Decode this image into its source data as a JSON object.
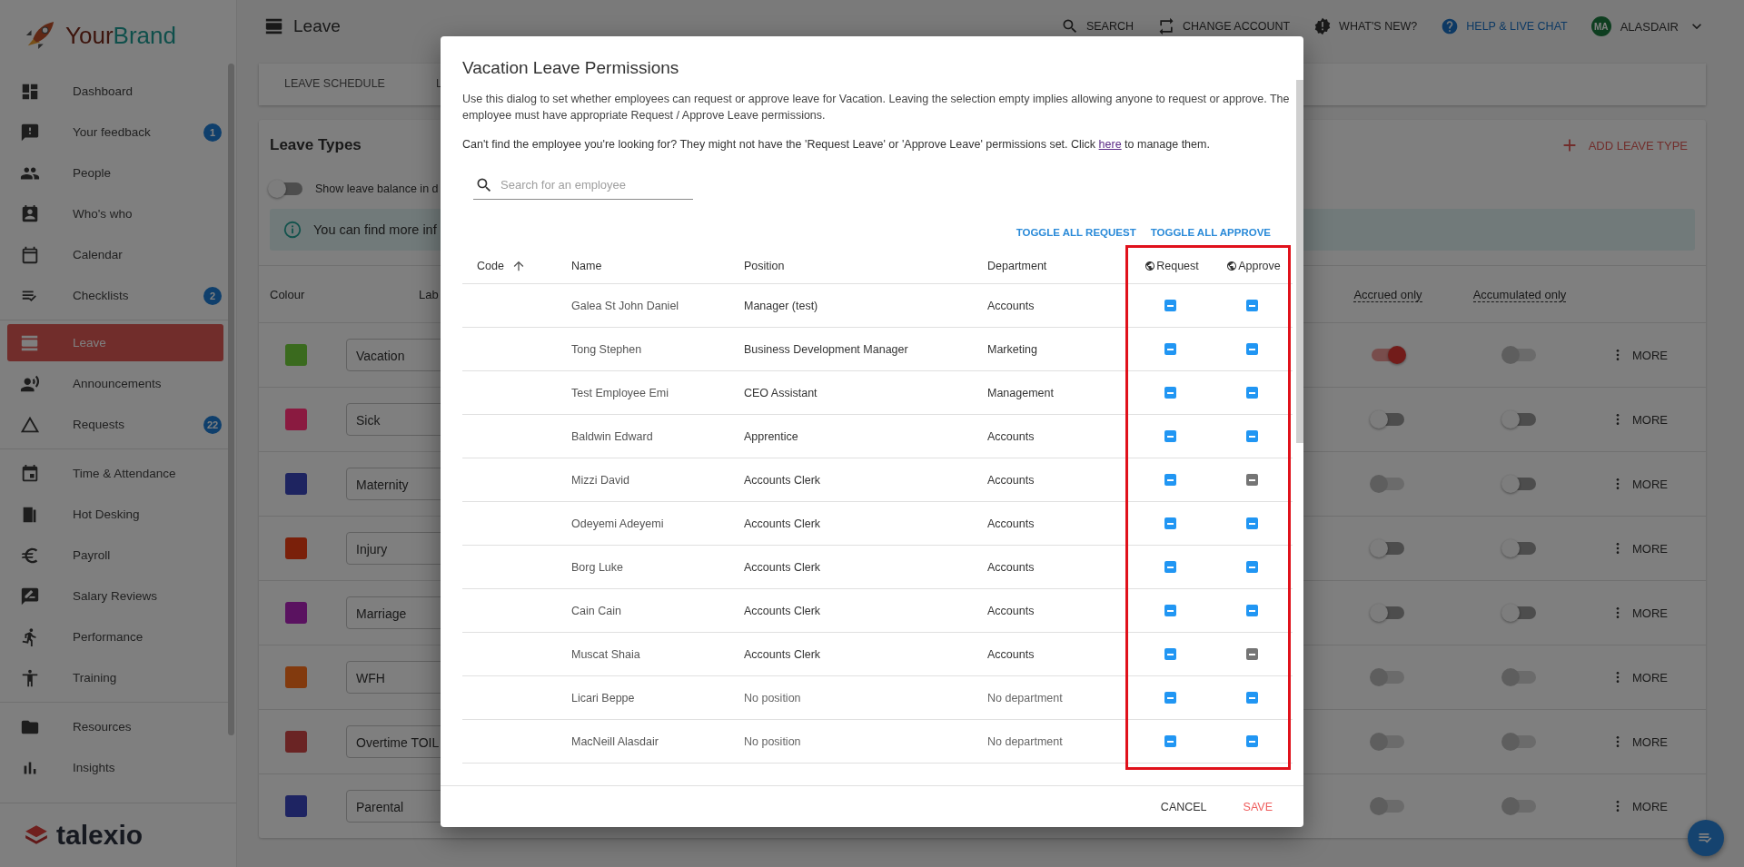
{
  "brand": {
    "parts": [
      "Your",
      "Brand"
    ]
  },
  "sidebar": {
    "groups": [
      [
        {
          "label": "Dashboard",
          "selected": false
        },
        {
          "label": "Your feedback",
          "badge": "1",
          "selected": false
        },
        {
          "label": "People",
          "selected": false
        },
        {
          "label": "Who's who",
          "selected": false
        },
        {
          "label": "Calendar",
          "selected": false
        },
        {
          "label": "Checklists",
          "badge": "2",
          "selected": false
        }
      ],
      [
        {
          "label": "Leave",
          "selected": true
        },
        {
          "label": "Announcements",
          "selected": false
        },
        {
          "label": "Requests",
          "badge": "22",
          "selected": false
        }
      ],
      [
        {
          "label": "Time & Attendance",
          "selected": false
        },
        {
          "label": "Hot Desking",
          "selected": false
        },
        {
          "label": "Payroll",
          "selected": false
        },
        {
          "label": "Salary Reviews",
          "selected": false
        },
        {
          "label": "Performance",
          "selected": false
        },
        {
          "label": "Training",
          "selected": false
        }
      ],
      [
        {
          "label": "Resources",
          "selected": false
        },
        {
          "label": "Insights",
          "selected": false
        }
      ]
    ]
  },
  "footer_logo": "talexio",
  "topbar": {
    "title": "Leave",
    "actions": [
      {
        "kind": "search",
        "label": "SEARCH"
      },
      {
        "kind": "switch",
        "label": "CHANGE ACCOUNT"
      },
      {
        "kind": "news",
        "label": "WHAT'S NEW?"
      },
      {
        "kind": "help",
        "label": "HELP & LIVE CHAT"
      }
    ],
    "user": {
      "initials": "MA",
      "name": "ALASDAIR"
    }
  },
  "tabs": [
    {
      "label": "LEAVE SCHEDULE",
      "selected": false
    },
    {
      "label": "L",
      "selected": false
    }
  ],
  "leave_types": {
    "title": "Leave Types",
    "add_button": "ADD LEAVE TYPE",
    "balance_toggle": {
      "label": "Show leave balance in d",
      "on": false
    },
    "info": "You can find more inf",
    "columns": [
      "Colour",
      "Lab",
      "Accrued only",
      "Accumulated only"
    ],
    "rows": [
      {
        "color": "#3a6a1e",
        "label": "Vacation",
        "accrued": {
          "on": true,
          "disabled": false
        },
        "accumulated": {
          "on": false,
          "disabled": true
        },
        "more": "MORE"
      },
      {
        "color": "#8a1a40",
        "label": "Sick",
        "accrued": {
          "on": false,
          "disabled": false
        },
        "accumulated": {
          "on": false,
          "disabled": false
        },
        "more": "MORE"
      },
      {
        "color": "#1e2460",
        "label": "Maternity",
        "accrued": {
          "on": false,
          "disabled": true
        },
        "accumulated": {
          "on": false,
          "disabled": false
        },
        "more": "MORE"
      },
      {
        "color": "#7a200a",
        "label": "Injury",
        "accrued": {
          "on": false,
          "disabled": false
        },
        "accumulated": {
          "on": false,
          "disabled": false
        },
        "more": "MORE"
      },
      {
        "color": "#5a1260",
        "label": "Marriage",
        "accrued": {
          "on": false,
          "disabled": false
        },
        "accumulated": {
          "on": false,
          "disabled": false
        },
        "more": "MORE"
      },
      {
        "color": "#823a0e",
        "label": "WFH",
        "accrued": {
          "on": false,
          "disabled": true
        },
        "accumulated": {
          "on": false,
          "disabled": true
        },
        "more": "MORE"
      },
      {
        "color": "#6a2424",
        "label": "Overtime TOIL",
        "accrued": {
          "on": false,
          "disabled": true
        },
        "accumulated": {
          "on": false,
          "disabled": true
        },
        "more": "MORE"
      },
      {
        "color": "#1e2462",
        "label": "Parental",
        "accrued": {
          "on": false,
          "disabled": true
        },
        "accumulated": {
          "on": false,
          "disabled": true
        },
        "more": "MORE"
      }
    ]
  },
  "dialog": {
    "title": "Vacation Leave Permissions",
    "intro": "Use this dialog to set whether employees can request or approve leave for Vacation. Leaving the selection empty implies allowing anyone to request or approve. The employee must have appropriate Request / Approve Leave permissions.",
    "hint": {
      "before": "Can't find the employee you're looking for? They might not have the 'Request Leave' or 'Approve Leave' permissions set. Click ",
      "link": "here",
      "after": " to manage them."
    },
    "search": {
      "placeholder": "Search for an employee"
    },
    "toggle_buttons": [
      "TOGGLE ALL REQUEST",
      "TOGGLE ALL APPROVE"
    ],
    "columns": [
      {
        "label": "Code",
        "sorted": true
      },
      {
        "label": "Name",
        "sorted": false
      },
      {
        "label": "Position",
        "sorted": false
      },
      {
        "label": "Department",
        "sorted": false
      },
      {
        "label": "Request",
        "sorted": false
      },
      {
        "label": "Approve",
        "sorted": false
      }
    ],
    "rows": [
      {
        "name": "Galea St John Daniel",
        "position": "Manager (test)",
        "department": "Accounts",
        "unassigned": false,
        "request": {
          "disabled": false
        },
        "approve": {
          "disabled": false
        }
      },
      {
        "name": "Tong Stephen",
        "position": "Business Development Manager",
        "department": "Marketing",
        "unassigned": false,
        "request": {
          "disabled": false
        },
        "approve": {
          "disabled": false
        }
      },
      {
        "name": "Test Employee Emi",
        "position": "CEO Assistant",
        "department": "Management",
        "unassigned": false,
        "request": {
          "disabled": false
        },
        "approve": {
          "disabled": false
        }
      },
      {
        "name": "Baldwin Edward",
        "position": "Apprentice",
        "department": "Accounts",
        "unassigned": false,
        "request": {
          "disabled": false
        },
        "approve": {
          "disabled": false
        }
      },
      {
        "name": "Mizzi David",
        "position": "Accounts Clerk",
        "department": "Accounts",
        "unassigned": false,
        "request": {
          "disabled": false
        },
        "approve": {
          "disabled": true
        }
      },
      {
        "name": "Odeyemi Adeyemi",
        "position": "Accounts Clerk",
        "department": "Accounts",
        "unassigned": false,
        "request": {
          "disabled": false
        },
        "approve": {
          "disabled": false
        }
      },
      {
        "name": "Borg Luke",
        "position": "Accounts Clerk",
        "department": "Accounts",
        "unassigned": false,
        "request": {
          "disabled": false
        },
        "approve": {
          "disabled": false
        }
      },
      {
        "name": "Cain Cain",
        "position": "Accounts Clerk",
        "department": "Accounts",
        "unassigned": false,
        "request": {
          "disabled": false
        },
        "approve": {
          "disabled": false
        }
      },
      {
        "name": "Muscat Shaia",
        "position": "Accounts Clerk",
        "department": "Accounts",
        "unassigned": false,
        "request": {
          "disabled": false
        },
        "approve": {
          "disabled": true
        }
      },
      {
        "name": "Licari Beppe",
        "position": "No position",
        "department": "No department",
        "unassigned": true,
        "request": {
          "disabled": false
        },
        "approve": {
          "disabled": false
        }
      },
      {
        "name": "MacNeill Alasdair",
        "position": "No position",
        "department": "No department",
        "unassigned": true,
        "request": {
          "disabled": false
        },
        "approve": {
          "disabled": false
        }
      }
    ],
    "buttons": [
      {
        "kind": "cancel",
        "label": "CANCEL"
      },
      {
        "kind": "save",
        "label": "SAVE"
      }
    ]
  }
}
